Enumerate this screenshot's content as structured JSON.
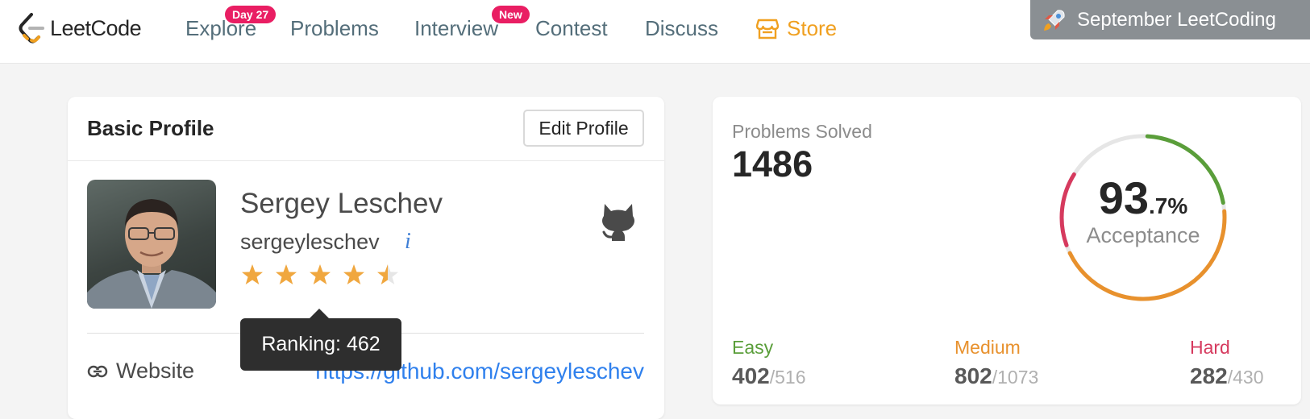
{
  "nav": {
    "logo_text": "LeetCode",
    "items": [
      {
        "label": "Explore",
        "badge": "Day 27"
      },
      {
        "label": "Problems"
      },
      {
        "label": "Interview",
        "badge": "New"
      },
      {
        "label": "Contest"
      },
      {
        "label": "Discuss"
      },
      {
        "label": "Store",
        "icon": "store-icon"
      }
    ],
    "promo_text": "September LeetCoding",
    "promo_icon": "rocket-icon",
    "colors": {
      "badge": "#e91e63",
      "store": "#f0a020",
      "nav_text": "#546e7a"
    }
  },
  "profile": {
    "card_title": "Basic Profile",
    "edit_label": "Edit Profile",
    "full_name": "Sergey Leschev",
    "username": "sergeyleschev",
    "info_icon": "i",
    "rating_stars": 4.5,
    "rating_max": 5,
    "ranking_tooltip": "Ranking: 462",
    "website_label": "Website",
    "website_url": "https://github.com/sergeyleschev",
    "icons": [
      "github-icon",
      "link-icon",
      "info-icon",
      "star-icon"
    ],
    "star_color": "#f0a73f"
  },
  "stats": {
    "solved_label": "Problems Solved",
    "solved_value": "1486",
    "acceptance_int": "93",
    "acceptance_dec": ".7%",
    "acceptance_label": "Acceptance",
    "difficulties": [
      {
        "label": "Easy",
        "solved": "402",
        "total": "/516",
        "color": "#5a9e3a",
        "solved_n": 402,
        "total_n": 516
      },
      {
        "label": "Medium",
        "solved": "802",
        "total": "/1073",
        "color": "#e8912d",
        "solved_n": 802,
        "total_n": 1073
      },
      {
        "label": "Hard",
        "solved": "282",
        "total": "/430",
        "color": "#d63a5e",
        "solved_n": 282,
        "total_n": 430
      }
    ]
  }
}
